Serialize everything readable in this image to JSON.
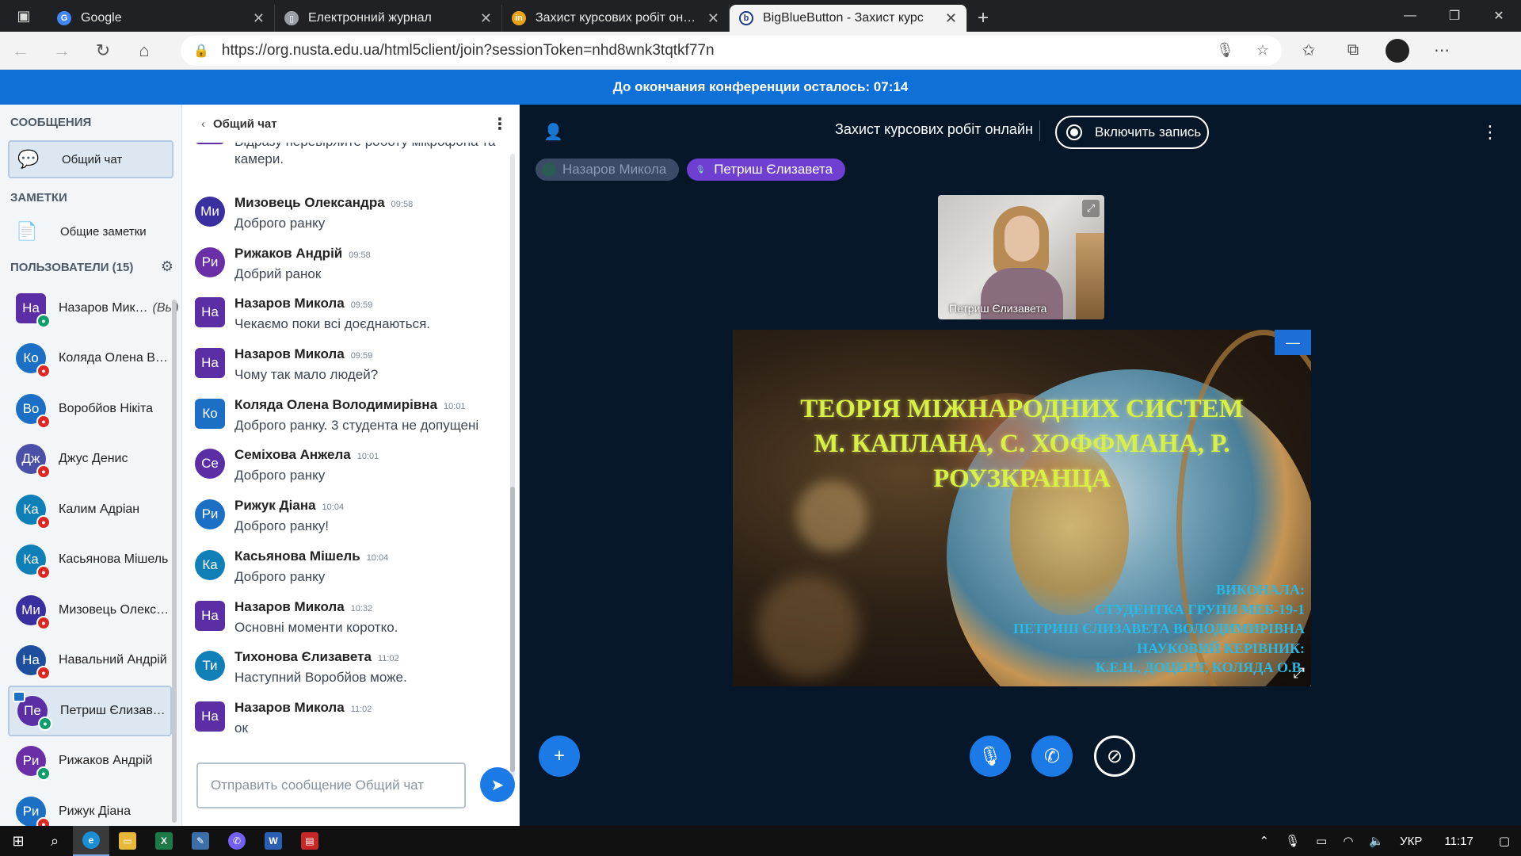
{
  "browser": {
    "tabs": [
      {
        "title": "Google",
        "icon": "google-favicon",
        "color": "#4285f4",
        "glyph": "G"
      },
      {
        "title": "Електронний журнал",
        "icon": "page-favicon",
        "color": "#9aa0a6",
        "glyph": "▯"
      },
      {
        "title": "Захист курсових робіт онлайн",
        "icon": "in-favicon",
        "color": "#e8a317",
        "glyph": "in"
      },
      {
        "title": "BigBlueButton - Захист курс",
        "icon": "bbb-favicon",
        "color": "#ffffff",
        "glyph": "b",
        "active": true
      }
    ],
    "url": "https://org.nusta.edu.ua/html5client/join?sessionToken=nhd8wnk3tqtkf77n"
  },
  "banner": {
    "text": "До окончания конференции осталось: 07:14"
  },
  "sidebar": {
    "messages_title": "СООБЩЕНИЯ",
    "public_chat_label": "Общий чат",
    "notes_title": "ЗАМЕТКИ",
    "shared_notes_label": "Общие заметки",
    "users_title": "ПОЛЬЗОВАТЕЛИ (15)",
    "you_suffix": "(Вы)",
    "users": [
      {
        "initials": "На",
        "name": "Назаров Мик…",
        "color": "#5b2ea6",
        "mic": "on",
        "you": true,
        "shape": "square"
      },
      {
        "initials": "Ко",
        "name": "Коляда Олена Во…",
        "color": "#1b6fc5",
        "mic": "off",
        "shape": "round"
      },
      {
        "initials": "Во",
        "name": "Воробйов Нікіта",
        "color": "#1b6fc5",
        "mic": "off",
        "shape": "round"
      },
      {
        "initials": "Дж",
        "name": "Джус Денис",
        "color": "#4a4fa8",
        "mic": "off",
        "shape": "round"
      },
      {
        "initials": "Ка",
        "name": "Калим Адріан",
        "color": "#0f7fb8",
        "mic": "off",
        "shape": "round"
      },
      {
        "initials": "Ка",
        "name": "Касьянова Мішель",
        "color": "#0f7fb8",
        "mic": "off",
        "shape": "round"
      },
      {
        "initials": "Ми",
        "name": "Мизовець Олекса…",
        "color": "#3a2f9e",
        "mic": "off",
        "shape": "round"
      },
      {
        "initials": "На",
        "name": "Навальний Андрій",
        "color": "#1d4f9e",
        "mic": "off",
        "shape": "round"
      },
      {
        "initials": "Пе",
        "name": "Петриш Єлизавета",
        "color": "#5b2ea6",
        "mic": "on",
        "presenter": true,
        "selected": true,
        "shape": "round"
      },
      {
        "initials": "Ри",
        "name": "Рижаков Андрій",
        "color": "#6a2fa6",
        "mic": "on",
        "shape": "round"
      },
      {
        "initials": "Ри",
        "name": "Рижук Діана",
        "color": "#1b6fc5",
        "mic": "off",
        "shape": "round"
      }
    ]
  },
  "chat": {
    "title": "Общий чат",
    "first_message_text": "Відразу перевіряйте роботу мікрофона та камери.",
    "messages": [
      {
        "initials": "Ми",
        "author": "Мизовець Олександра",
        "time": "09:58",
        "text": "Доброго ранку",
        "color": "#3a2f9e",
        "shape": "round"
      },
      {
        "initials": "Ри",
        "author": "Рижаков Андрій",
        "time": "09:58",
        "text": "Добрий ранок",
        "color": "#6a2fa6",
        "shape": "round"
      },
      {
        "initials": "На",
        "author": "Назаров Микола",
        "time": "09:59",
        "text": "Чекаємо поки всі доєднаються.",
        "color": "#5b2ea6",
        "shape": "square"
      },
      {
        "initials": "На",
        "author": "Назаров Микола",
        "time": "09:59",
        "text": "Чому так мало людей?",
        "color": "#5b2ea6",
        "shape": "square"
      },
      {
        "initials": "Ко",
        "author": "Коляда Олена Володимирівна",
        "time": "10:01",
        "text": "Доброго ранку. 3 студента не допущені",
        "color": "#1b6fc5",
        "shape": "square"
      },
      {
        "initials": "Се",
        "author": "Семіхова Анжела",
        "time": "10:01",
        "text": "Доброго ранку",
        "color": "#5b2ea6",
        "shape": "round"
      },
      {
        "initials": "Ри",
        "author": "Рижук Діана",
        "time": "10:04",
        "text": "Доброго ранку!",
        "color": "#1b6fc5",
        "shape": "round"
      },
      {
        "initials": "Ка",
        "author": "Касьянова Мішель",
        "time": "10:04",
        "text": "Доброго ранку",
        "color": "#0f7fb8",
        "shape": "round"
      },
      {
        "initials": "На",
        "author": "Назаров Микола",
        "time": "10:32",
        "text": "Основні моменти коротко.",
        "color": "#5b2ea6",
        "shape": "square"
      },
      {
        "initials": "Ти",
        "author": "Тихонова Єлизавета",
        "time": "11:02",
        "text": "Наступний Воробйов може.",
        "color": "#0f7fb8",
        "shape": "round"
      },
      {
        "initials": "На",
        "author": "Назаров Микола",
        "time": "11:02",
        "text": "ок",
        "color": "#5b2ea6",
        "shape": "square"
      }
    ],
    "input_placeholder": "Отправить сообщение Общий чат"
  },
  "main": {
    "meeting_title": "Захист курсових робіт онлайн",
    "record_label": "Включить запись",
    "talkers": [
      {
        "name": "Назаров Микола",
        "state": "muted"
      },
      {
        "name": "Петриш Єлизавета",
        "state": "speaking"
      }
    ],
    "webcam_label": "Петриш Єлизавета",
    "slide": {
      "title_lines": [
        "ТЕОРІЯ МІЖНАРОДНИХ СИСТЕМ",
        "М. КАПЛАНА, С. ХОФФМАНА, Р.",
        "РОУЗКРАНЦА"
      ],
      "credit_lines": [
        "ВИКОНАЛА:",
        "СТУДЕНТКА ГРУПИ МЕБ-19-1",
        "ПЕТРИШ ЄЛИЗАВЕТА ВОЛОДИМИРІВНА",
        "НАУКОВИЙ КЕРІВНИК:",
        "К.Е.Н., ДОЦЕНТ, КОЛЯДА О.В."
      ]
    }
  },
  "taskbar": {
    "language": "УКР",
    "clock": "11:17"
  }
}
